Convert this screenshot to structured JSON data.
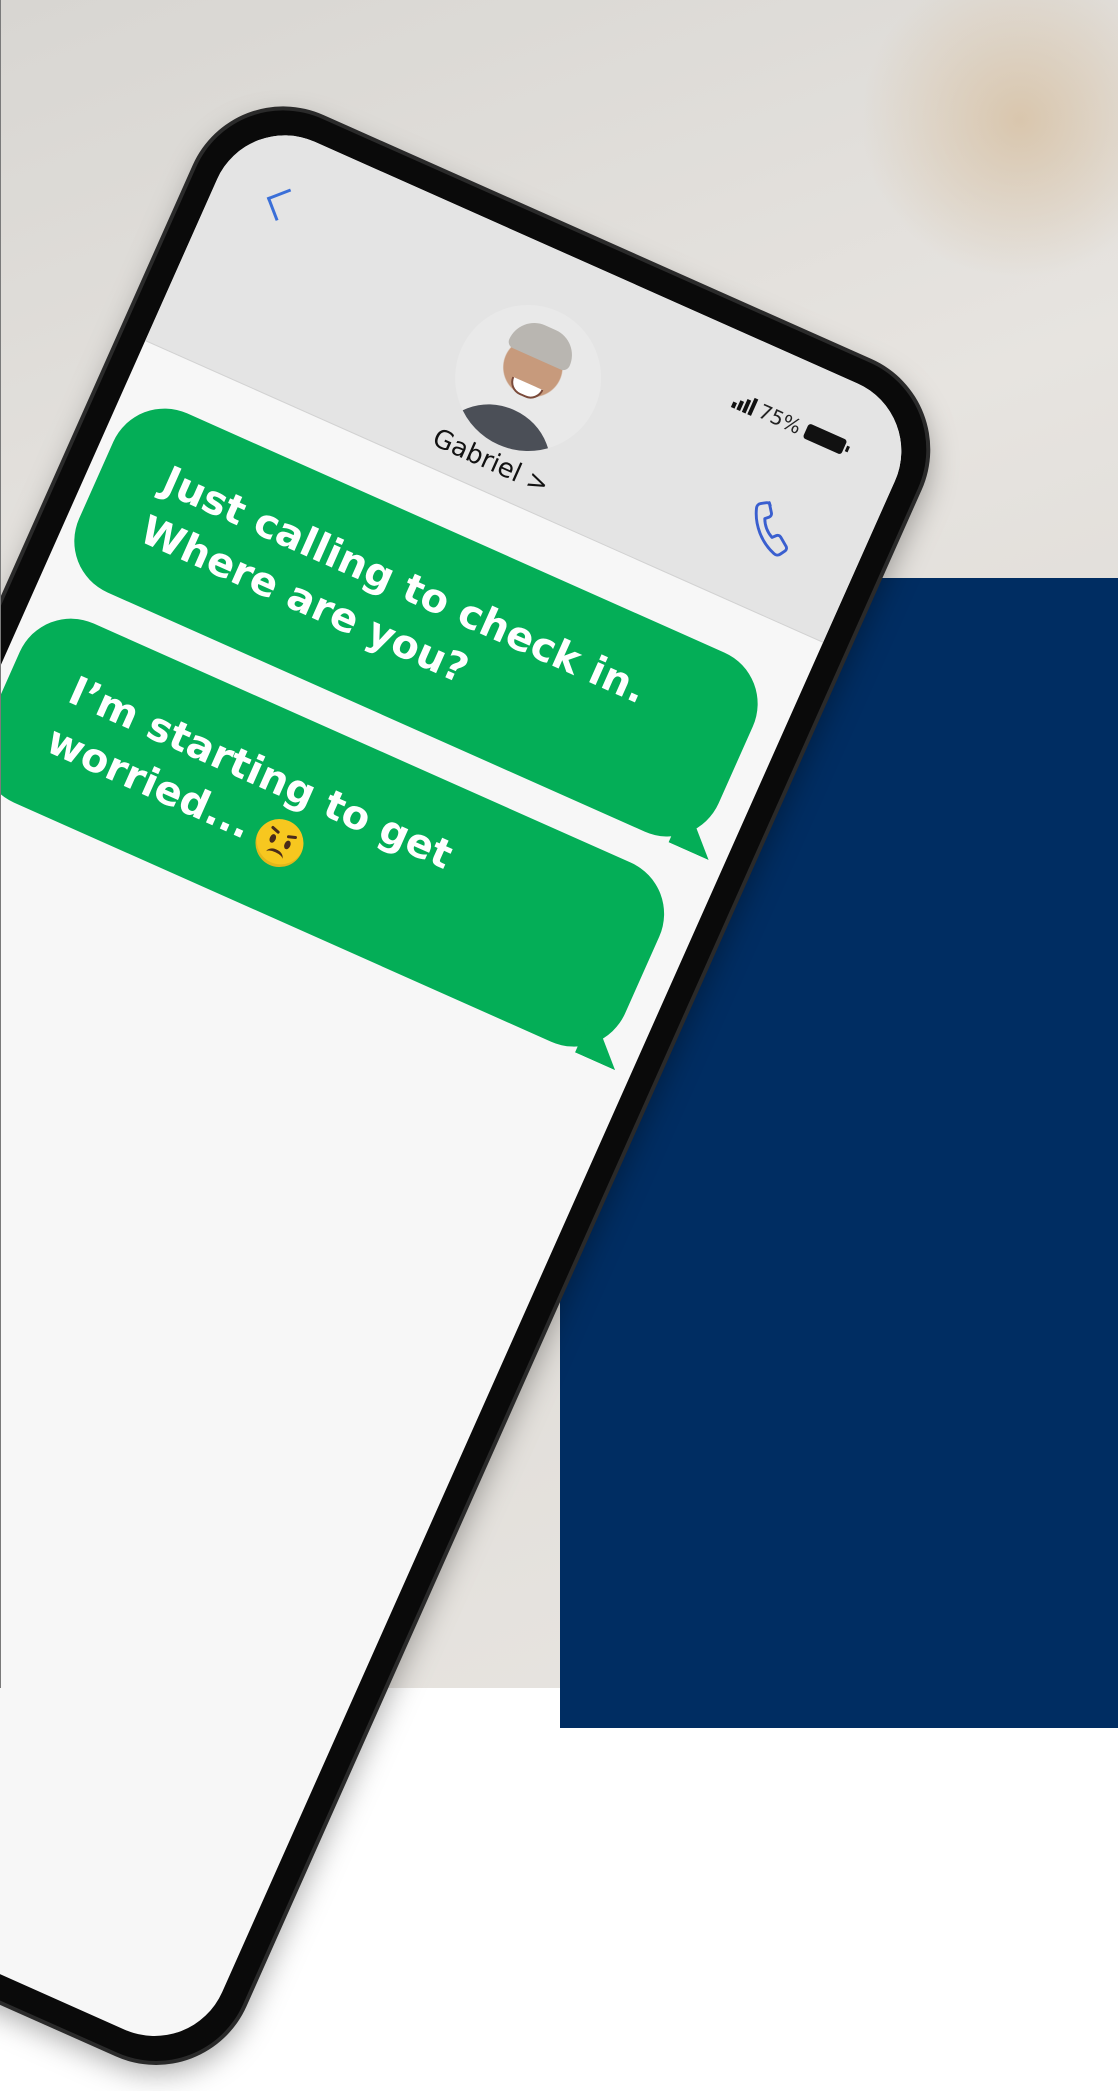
{
  "background": {
    "accent_color": "#002d62"
  },
  "conversation": {
    "header": {
      "contact_name": "Gabriel >",
      "status": {
        "signal": "ııl",
        "battery": "75%"
      }
    },
    "messages": [
      {
        "lines": [
          "Just calling to check in.",
          "Where are you?"
        ],
        "color": "#04ae57"
      },
      {
        "lines": [
          "I’m starting to get",
          "worried..."
        ],
        "emoji": "worried-face",
        "color": "#04ae57"
      }
    ]
  },
  "icons": [
    "back-chevron-icon",
    "signal-icon",
    "battery-icon",
    "phone-call-icon",
    "worried-face-emoji"
  ]
}
